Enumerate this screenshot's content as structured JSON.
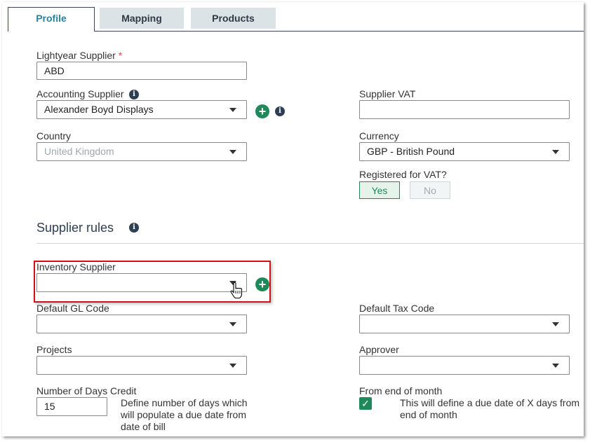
{
  "tabs": [
    {
      "label": "Profile",
      "active": true
    },
    {
      "label": "Mapping",
      "active": false
    },
    {
      "label": "Products",
      "active": false
    }
  ],
  "form": {
    "lightyear_supplier": {
      "label": "Lightyear Supplier",
      "required_mark": "*",
      "value": "ABD"
    },
    "accounting_supplier": {
      "label": "Accounting Supplier",
      "value": "Alexander Boyd Displays"
    },
    "supplier_vat": {
      "label": "Supplier VAT",
      "value": ""
    },
    "country": {
      "label": "Country",
      "value": "United Kingdom"
    },
    "currency": {
      "label": "Currency",
      "value": "GBP - British Pound"
    },
    "registered_vat": {
      "label": "Registered for VAT?",
      "yes": "Yes",
      "no": "No",
      "selected": "Yes"
    }
  },
  "rules": {
    "title": "Supplier rules",
    "inventory_supplier": {
      "label": "Inventory Supplier",
      "value": ""
    },
    "default_gl_code": {
      "label": "Default GL Code",
      "value": ""
    },
    "default_tax_code": {
      "label": "Default Tax Code",
      "value": ""
    },
    "projects": {
      "label": "Projects",
      "value": ""
    },
    "approver": {
      "label": "Approver",
      "value": ""
    },
    "days_credit": {
      "label": "Number of Days Credit",
      "value": "15",
      "help_lines": [
        "Define number of days which",
        "will populate a due date from",
        "date of bill"
      ]
    },
    "end_of_month": {
      "label": "From end of month",
      "checked": true,
      "help_lines": [
        "This will define a due date of X days from",
        "end of month"
      ]
    }
  },
  "icons": {
    "plus": "+",
    "info": "i",
    "check": "✓"
  },
  "colors": {
    "accent_green": "#1e8a5a",
    "tab_active_text": "#2c8197",
    "highlight_red": "#d0101b",
    "heading": "#2f3f52"
  }
}
